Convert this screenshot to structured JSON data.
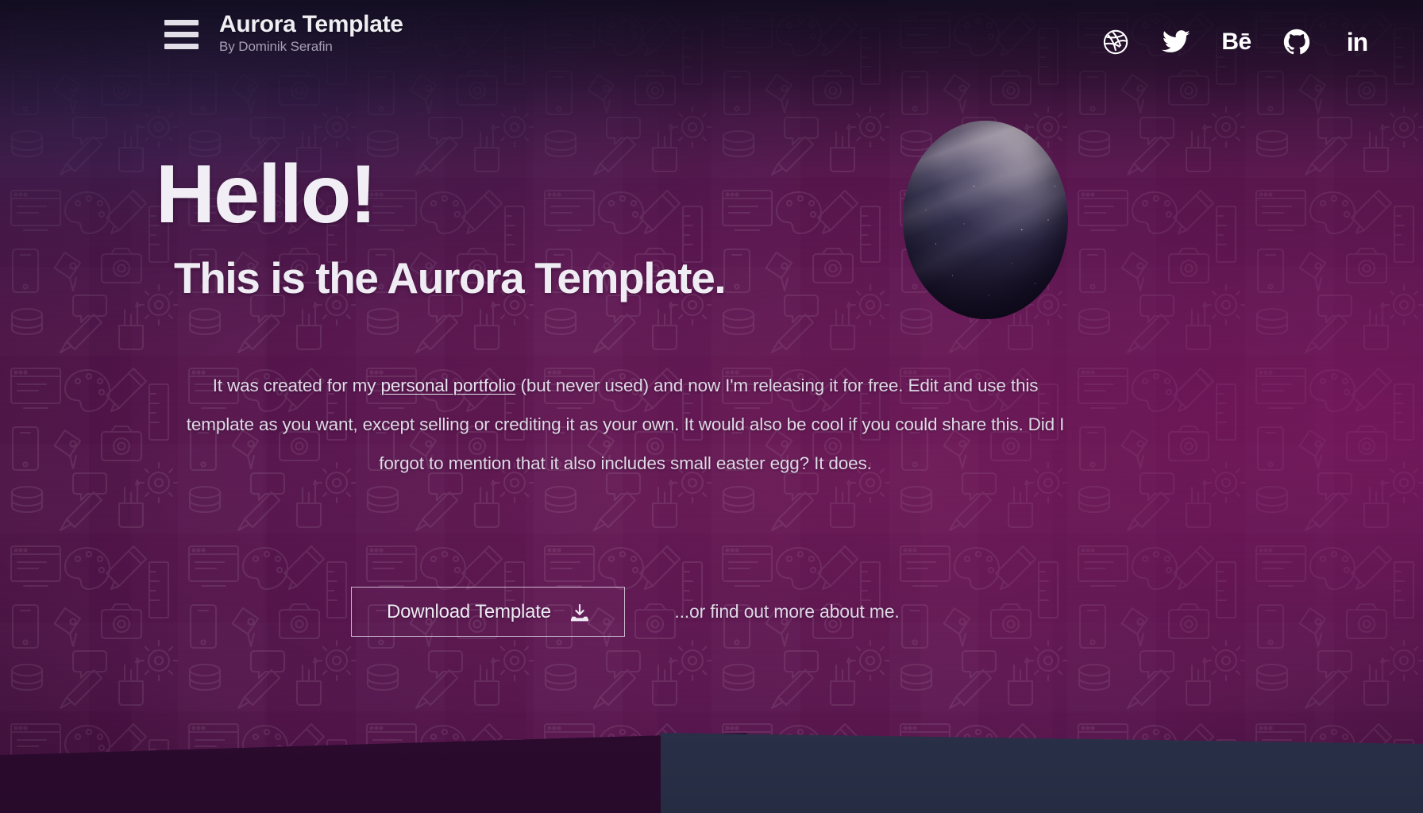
{
  "header": {
    "menu_icon": "hamburger-menu-icon",
    "brand_title": "Aurora Template",
    "brand_subtitle": "By Dominik Serafin",
    "socials": [
      {
        "name": "dribbble",
        "label": "Dribbble"
      },
      {
        "name": "twitter",
        "label": "Twitter"
      },
      {
        "name": "behance",
        "label": "Behance",
        "glyph": "Bē"
      },
      {
        "name": "github",
        "label": "GitHub"
      },
      {
        "name": "linkedin",
        "label": "LinkedIn",
        "glyph": "in"
      }
    ]
  },
  "hero": {
    "heading": "Hello!",
    "subheading": "This is the Aurora Template.",
    "paragraph_before_link": "It was created for my ",
    "paragraph_link": "personal portfolio",
    "paragraph_after_link": " (but never used) and now I'm releasing it for free. Edit and use this template as you want, except selling or crediting it as your own. It would also be cool if you could share this. Did I forgot to mention that it also includes small easter egg? It does.",
    "download_button": "Download Template",
    "download_icon": "download-icon",
    "secondary_note": "...or find out more about me.",
    "planet_graphic": "aurora-planet"
  },
  "colors": {
    "background_magenta": "#5b1750",
    "background_deep": "#330c33",
    "background_night_blue": "#2e2654",
    "text_primary": "#f1eff5",
    "text_secondary": "#a79fb5",
    "text_body": "#dfd9e6",
    "button_border": "#e8e2f0",
    "next_section_left": "#2b0b2e",
    "next_section_right": "#2a3048"
  }
}
